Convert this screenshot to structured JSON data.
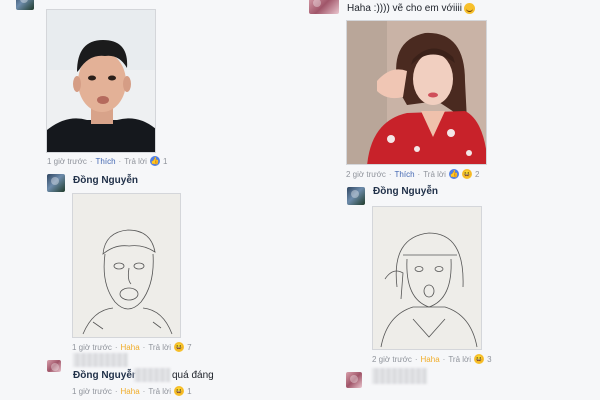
{
  "left_column": {
    "comment1": {
      "time": "1 giờ trước",
      "like": "Thích",
      "reply": "Trả lời",
      "reaction_count": "1"
    },
    "comment2": {
      "author": "Đồng Nguyễn",
      "time": "1 giờ trước",
      "reaction": "Haha",
      "reply": "Trả lời",
      "reaction_count": "7"
    },
    "comment3": {
      "author": "Đồng Nguyễn",
      "text": "quá đáng",
      "time": "1 giờ trước",
      "reaction": "Haha",
      "reply": "Trả lời",
      "reaction_count": "1"
    }
  },
  "right_column": {
    "comment1": {
      "text": "Haha :)))) vẽ cho em vớiiii",
      "time": "2 giờ trước",
      "like": "Thích",
      "reply": "Trả lời",
      "reaction_count": "2"
    },
    "comment2": {
      "author": "Đồng Nguyễn",
      "time": "2 giờ trước",
      "reaction": "Haha",
      "reply": "Trả lời",
      "reaction_count": "3"
    }
  },
  "icons": {
    "like": "like-icon",
    "haha": "haha-icon",
    "emoji": "grin-emoji-icon"
  },
  "colors": {
    "link": "#4267b2",
    "haha": "#f0ad2a",
    "meta": "#90949c",
    "author": "#22324a"
  }
}
